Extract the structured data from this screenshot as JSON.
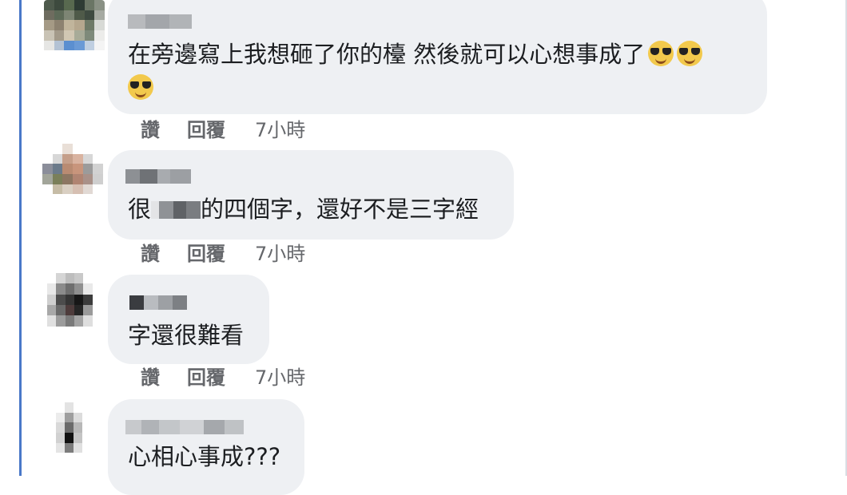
{
  "comments": [
    {
      "text_line1": "在旁邊寫上我想砸了你的檯 然後就可以心想事成了",
      "emoji": "smiling-face-with-sunglasses",
      "like": "讚",
      "reply": "回覆",
      "time": "7小時"
    },
    {
      "text_before": "很",
      "text_after": "的四個字，還好不是三字經",
      "like": "讚",
      "reply": "回覆",
      "time": "7小時"
    },
    {
      "text": "字還很難看",
      "like": "讚",
      "reply": "回覆",
      "time": "7小時"
    },
    {
      "text": "心相心事成???"
    }
  ]
}
